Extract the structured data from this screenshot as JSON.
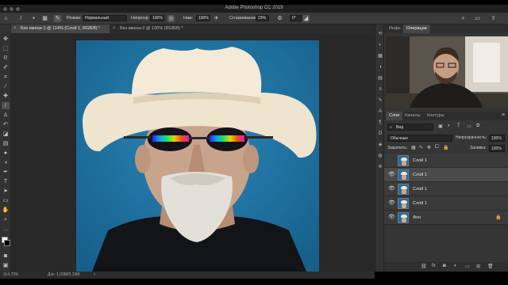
{
  "app": {
    "title": "Adobe Photoshop CC 2019"
  },
  "options_bar": {
    "mode_label": "Режим:",
    "mode_value": "Нормальный",
    "opacity_label": "Непрозр:",
    "opacity_value": "100%",
    "pressure_label": "Наж:",
    "pressure_value": "100%",
    "smoothing_label": "Сглаживание:",
    "smoothing_value": "23%",
    "angle_value": "0°"
  },
  "document_tabs": [
    {
      "label": "Без имени-1 @ 114% (Слой 1, RGB/8) *"
    },
    {
      "label": "Без имени-2 @ 100% (RGB/8) *"
    }
  ],
  "status_bar": {
    "zoom": "114,73%",
    "doc_info": "Док: 1,03M/5,19M"
  },
  "top_panel": {
    "tabs": [
      "Инфо",
      "Операции"
    ]
  },
  "layers_panel": {
    "tabs": [
      "Слои",
      "Каналы",
      "Контуры"
    ],
    "filter_label": "Вид",
    "blend_mode": "Обычные",
    "opacity_label": "Непрозрачность:",
    "opacity_value": "100%",
    "lock_label": "Закрепить:",
    "fill_label": "Заливка:",
    "fill_value": "100%",
    "layers": [
      {
        "name": "Слой 1",
        "visible": false,
        "selected": false,
        "locked": false
      },
      {
        "name": "Слой 1",
        "visible": true,
        "selected": true,
        "locked": false
      },
      {
        "name": "Слой 1",
        "visible": true,
        "selected": false,
        "locked": false
      },
      {
        "name": "Слой 1",
        "visible": true,
        "selected": false,
        "locked": false
      },
      {
        "name": "Фон",
        "visible": true,
        "selected": false,
        "locked": true
      }
    ]
  },
  "colors": {
    "canvas_background": "#1f6f9f",
    "ui_dark": "#323232",
    "panel": "#353535",
    "selected_layer": "#4a4a4a"
  }
}
